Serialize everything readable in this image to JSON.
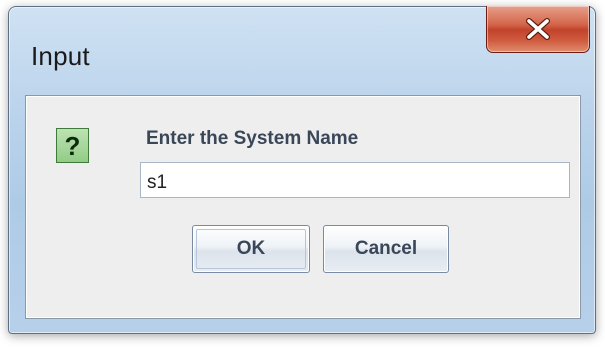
{
  "window": {
    "title": "Input"
  },
  "dialog": {
    "icon": "question-icon",
    "icon_glyph": "?",
    "prompt": "Enter the System Name",
    "input_value": "s1",
    "ok_label": "OK",
    "cancel_label": "Cancel"
  },
  "colors": {
    "close_button": "#c2432b",
    "question_icon_bg": "#92cc86",
    "label_text": "#3a4758"
  }
}
